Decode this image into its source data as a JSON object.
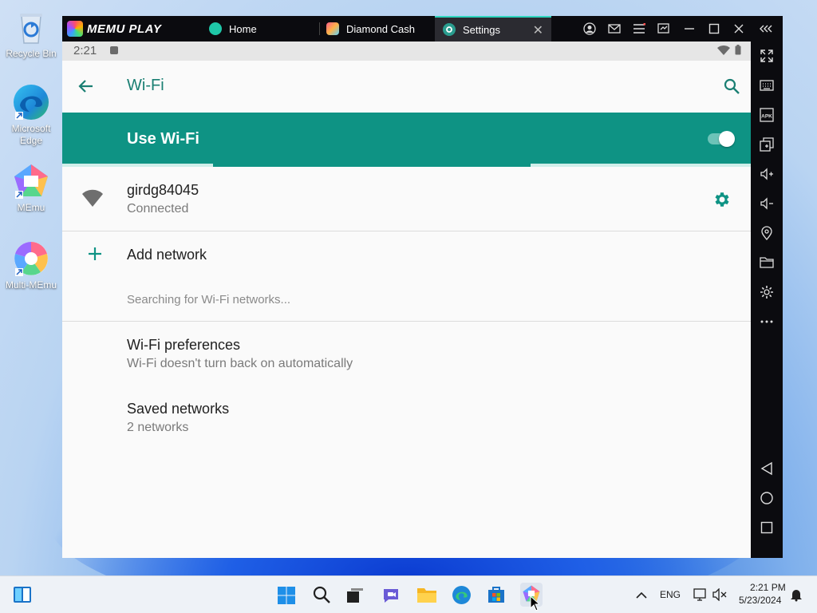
{
  "desktop": {
    "icons": [
      {
        "label": "Recycle Bin",
        "icon": "recycle-bin-icon"
      },
      {
        "label": "Microsoft Edge",
        "icon": "edge-icon"
      },
      {
        "label": "MEmu",
        "icon": "memu-icon"
      },
      {
        "label": "Multi-MEmu",
        "icon": "multi-memu-icon"
      }
    ]
  },
  "emulator": {
    "brand": "MEMU PLAY",
    "tabs": [
      {
        "label": "Home",
        "icon": "home-app-icon"
      },
      {
        "label": "Diamond Cash",
        "icon": "diamond-cash-app-icon"
      },
      {
        "label": "Settings",
        "icon": "settings-app-icon",
        "active": true
      }
    ],
    "titlebar_buttons": [
      "account-icon",
      "mail-icon",
      "menu-icon",
      "screen-record-icon",
      "minimize-icon",
      "maximize-icon",
      "close-icon",
      "collapse-sidebar-icon"
    ],
    "sidebar_buttons": [
      "fullscreen-icon",
      "keyboard-icon",
      "apk-icon",
      "multi-window-icon",
      "volume-up-icon",
      "volume-down-icon",
      "location-icon",
      "folder-icon",
      "settings-gear-icon",
      "more-icon",
      "back-triangle-icon",
      "home-circle-icon",
      "recents-square-icon"
    ]
  },
  "android": {
    "status_bar": {
      "time": "2:21"
    },
    "app_bar": {
      "title": "Wi-Fi"
    },
    "use_wifi": {
      "label": "Use Wi-Fi",
      "enabled": true
    },
    "current_network": {
      "name": "girdg84045",
      "status": "Connected"
    },
    "add_network": {
      "label": "Add network"
    },
    "searching_text": "Searching for Wi-Fi networks...",
    "preferences": {
      "title": "Wi-Fi preferences",
      "subtitle": "Wi-Fi doesn't turn back on automatically"
    },
    "saved": {
      "title": "Saved networks",
      "subtitle": "2 networks"
    }
  },
  "colors": {
    "accent": "#0e9384",
    "accent_text": "#1a7f73",
    "taskbar": "#eef2f7"
  },
  "taskbar": {
    "apps": [
      "widgets-icon",
      "start-icon",
      "search-icon",
      "task-view-icon",
      "teams-chat-icon",
      "file-explorer-icon",
      "edge-icon",
      "store-icon",
      "memu-icon"
    ],
    "language": "ENG",
    "time": "2:21 PM",
    "date": "5/23/2024"
  }
}
